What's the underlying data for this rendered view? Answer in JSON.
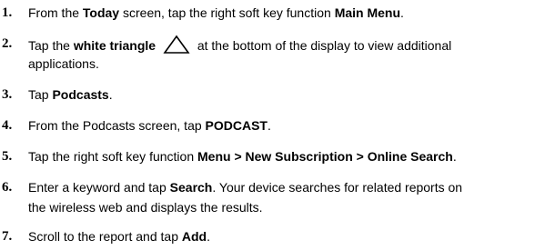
{
  "steps": [
    {
      "num": "1.",
      "lines": [
        [
          {
            "t": "From the "
          },
          {
            "t": "Today",
            "b": true
          },
          {
            "t": " screen, tap the right soft key function "
          },
          {
            "t": "Main Menu",
            "b": true
          },
          {
            "t": "."
          }
        ]
      ]
    },
    {
      "num": "2.",
      "lines": [
        [
          {
            "t": "Tap the "
          },
          {
            "t": "white triangle",
            "b": true
          },
          {
            "t": " "
          },
          {
            "icon": "triangle-outline-icon"
          },
          {
            "t": " at the bottom of the display to view additional"
          }
        ],
        [
          {
            "t": "applications."
          }
        ]
      ]
    },
    {
      "num": "3.",
      "lines": [
        [
          {
            "t": "Tap "
          },
          {
            "t": "Podcasts",
            "b": true
          },
          {
            "t": "."
          }
        ]
      ]
    },
    {
      "num": "4.",
      "lines": [
        [
          {
            "t": "From the Podcasts screen, tap "
          },
          {
            "t": "PODCAST",
            "b": true
          },
          {
            "t": "."
          }
        ]
      ]
    },
    {
      "num": "5.",
      "lines": [
        [
          {
            "t": "Tap the right soft key function "
          },
          {
            "t": "Menu > New Subscription > Online Search",
            "b": true
          },
          {
            "t": "."
          }
        ]
      ]
    },
    {
      "num": "6.",
      "lines": [
        [
          {
            "t": "Enter a keyword and tap "
          },
          {
            "t": "Search",
            "b": true
          },
          {
            "t": ". Your device searches for related reports on"
          }
        ],
        [
          {
            "t": "the wireless web and displays the results."
          }
        ]
      ]
    },
    {
      "num": "7.",
      "lines": [
        [
          {
            "t": "Scroll to the report and tap "
          },
          {
            "t": "Add",
            "b": true
          },
          {
            "t": "."
          }
        ]
      ]
    }
  ]
}
